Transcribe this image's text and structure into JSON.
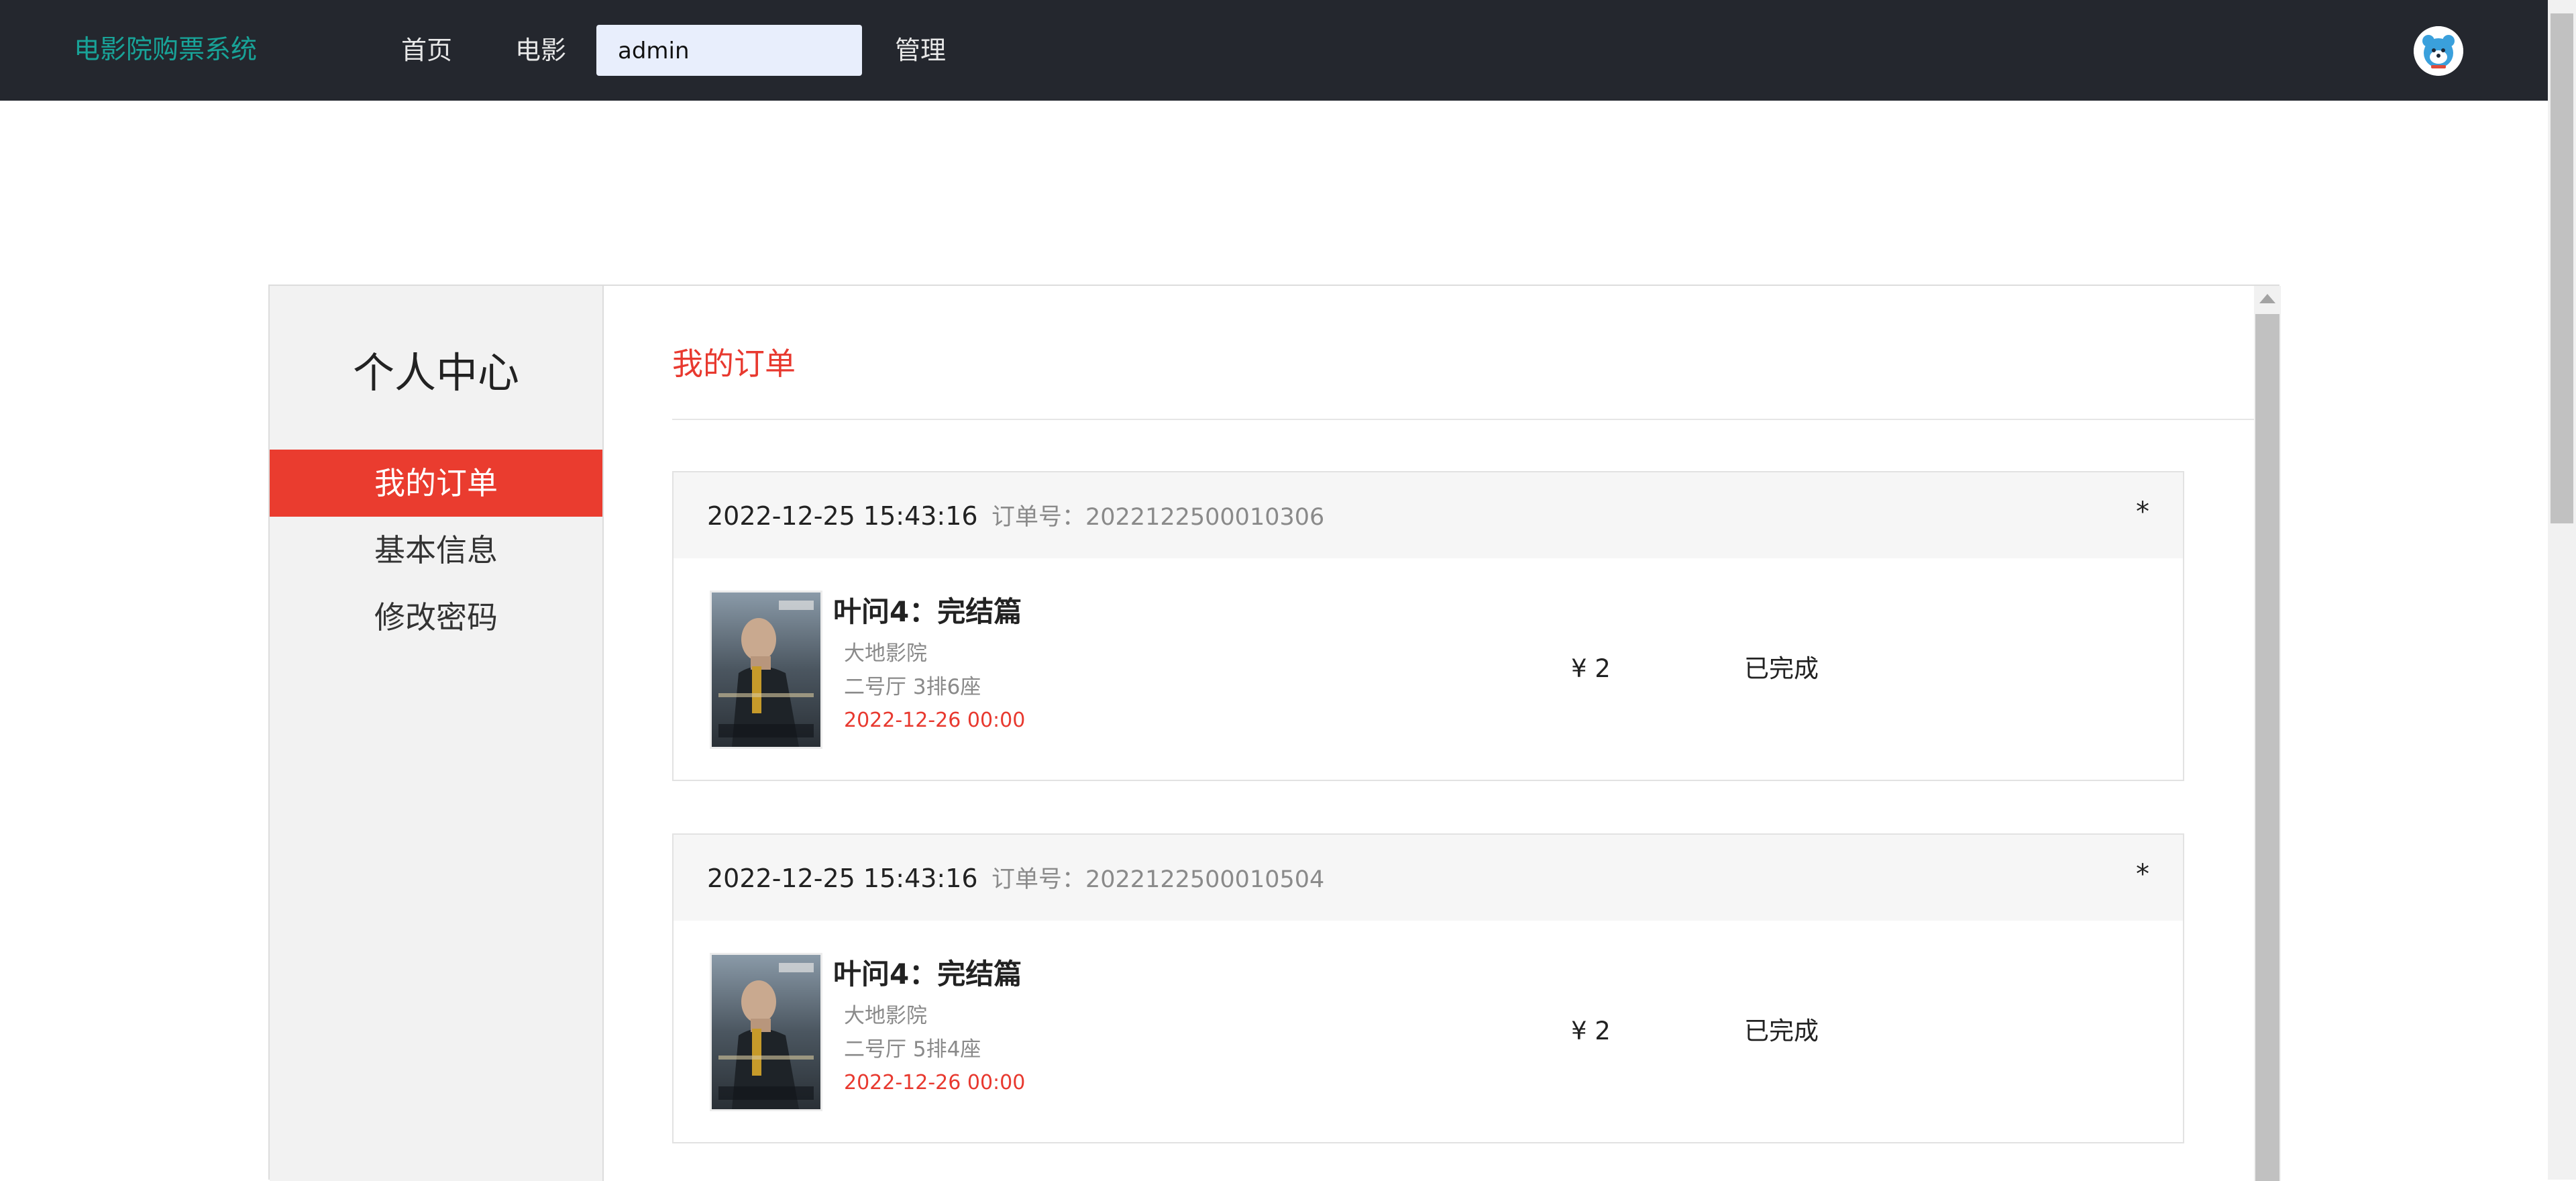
{
  "header": {
    "brand": "电影院购票系统",
    "nav": {
      "home": "首页",
      "movies": "电影",
      "user": "admin",
      "manage": "管理"
    }
  },
  "sidebar": {
    "title": "个人中心",
    "items": [
      {
        "label": "我的订单",
        "active": true
      },
      {
        "label": "基本信息",
        "active": false
      },
      {
        "label": "修改密码",
        "active": false
      }
    ]
  },
  "content": {
    "title": "我的订单",
    "order_no_label": "订单号：",
    "currency": "¥",
    "orders": [
      {
        "time": "2022-12-25 15:43:16",
        "order_no": "2022122500010306",
        "menu": "*",
        "movie": "叶问4：完结篇",
        "cinema": "大地影院",
        "seat": "二号厅 3排6座",
        "show_time": "2022-12-26 00:00",
        "price": "¥ 2",
        "status": "已完成"
      },
      {
        "time": "2022-12-25 15:43:16",
        "order_no": "2022122500010504",
        "menu": "*",
        "movie": "叶问4：完结篇",
        "cinema": "大地影院",
        "seat": "二号厅 5排4座",
        "show_time": "2022-12-26 00:00",
        "price": "¥ 2",
        "status": "已完成"
      }
    ]
  },
  "colors": {
    "topbar": "#24272e",
    "brand": "#18a398",
    "accent": "#ea3c2f"
  },
  "icons": [
    "user-avatar-icon",
    "scroll-up-arrow-icon"
  ]
}
